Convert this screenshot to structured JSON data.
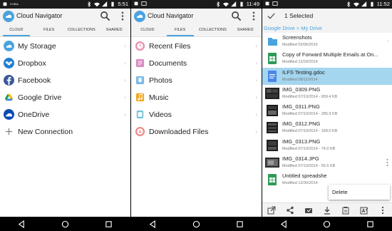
{
  "colors": {
    "accent": "#4aa3df",
    "selected_row": "#a4d6f0",
    "statusbar": "#1c1c1c",
    "appbar": "#f3f3f3"
  },
  "panels": [
    {
      "status_time": "5:51",
      "status_small": "3 KB/s",
      "app_title": "Cloud Navigator",
      "tabs": [
        "CLOUD",
        "FILES",
        "COLLECTIONS",
        "SHARED"
      ],
      "active_tab": 0,
      "items": [
        {
          "label": "My Storage",
          "icon": "cloud-storage-icon"
        },
        {
          "label": "Dropbox",
          "icon": "dropbox-icon"
        },
        {
          "label": "Facebook",
          "icon": "facebook-icon"
        },
        {
          "label": "Google Drive",
          "icon": "google-drive-icon"
        },
        {
          "label": "OneDrive",
          "icon": "onedrive-icon"
        },
        {
          "label": "New Connection",
          "icon": "plus-icon"
        }
      ]
    },
    {
      "status_time": "11:49",
      "app_title": "Cloud Navigator",
      "tabs": [
        "CLOUD",
        "FILES",
        "COLLECTIONS",
        "SHARED"
      ],
      "active_tab": 1,
      "items": [
        {
          "label": "Recent Files",
          "icon": "clock-icon"
        },
        {
          "label": "Documents",
          "icon": "document-icon"
        },
        {
          "label": "Photos",
          "icon": "camera-icon"
        },
        {
          "label": "Music",
          "icon": "music-icon"
        },
        {
          "label": "Videos",
          "icon": "video-icon"
        },
        {
          "label": "Downloaded Files",
          "icon": "download-icon"
        }
      ]
    },
    {
      "status_time": "11:52",
      "selected_text": "1 Selected",
      "breadcrumb": "Google Drive > My Drive",
      "files": [
        {
          "name": "Screenshots",
          "meta": "Modified 02/06/2015",
          "icon": "folder-icon"
        },
        {
          "name": "Copy of Forward Multiple Emails at On...",
          "meta": "Modified 12/29/2014",
          "icon": "sheet-icon"
        },
        {
          "name": "ILFS Testing.gdoc",
          "meta": "Modified 08/11/2014",
          "icon": "gdoc-icon"
        },
        {
          "name": "IMG_0309.PNG",
          "meta": "Modified 07/19/2014 - 659.4 KB",
          "icon": "image-thumb-icon"
        },
        {
          "name": "IMG_0311.PNG",
          "meta": "Modified 07/19/2014 - 285.9 KB",
          "icon": "image-thumb-icon"
        },
        {
          "name": "IMG_0312.PNG",
          "meta": "Modified 07/19/2014 - 168.0 KB",
          "icon": "image-thumb-icon"
        },
        {
          "name": "IMG_0313.PNG",
          "meta": "Modified 07/19/2014 - 74.0 KB",
          "icon": "image-thumb-icon"
        },
        {
          "name": "IMG_0314.JPG",
          "meta": "Modified 07/19/2014 - 55.6 KB",
          "icon": "image-thumb-icon"
        },
        {
          "name": "Untitled spreadshe",
          "meta": "Modified 12/30/2014",
          "icon": "sheet-icon"
        }
      ],
      "selected_index": 2,
      "popup_item": "Delete"
    }
  ]
}
